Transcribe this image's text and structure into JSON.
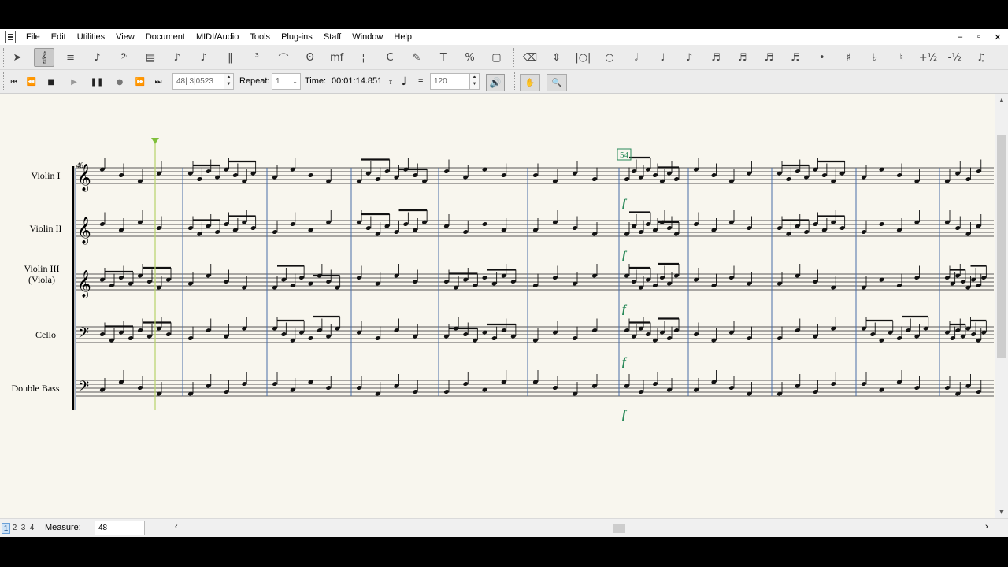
{
  "menu": {
    "items": [
      "File",
      "Edit",
      "Utilities",
      "View",
      "Document",
      "MIDI/Audio",
      "Tools",
      "Plug-ins",
      "Staff",
      "Window",
      "Help"
    ]
  },
  "window_controls": {
    "minimize": "–",
    "restore": "▫",
    "close": "✕"
  },
  "toolbar": {
    "tools": [
      {
        "name": "selection-tool-icon",
        "glyph": "➤"
      },
      {
        "name": "staff-tool-icon",
        "glyph": "𝄞"
      },
      {
        "name": "simple-entry-icon",
        "glyph": "≡"
      },
      {
        "name": "speedy-entry-icon",
        "glyph": "♪"
      },
      {
        "name": "clef-tool-icon",
        "glyph": "𝄢"
      },
      {
        "name": "key-signature-icon",
        "glyph": "▤"
      },
      {
        "name": "time-signature-icon",
        "glyph": "♪"
      },
      {
        "name": "note-mover-icon",
        "glyph": "♪"
      },
      {
        "name": "repeat-tool-icon",
        "glyph": "‖"
      },
      {
        "name": "tuplet-tool-icon",
        "glyph": "³"
      },
      {
        "name": "smart-shape-icon",
        "glyph": "⌒"
      },
      {
        "name": "articulation-icon",
        "glyph": "ʘ"
      },
      {
        "name": "expression-icon",
        "glyph": "mf"
      },
      {
        "name": "measure-tool-icon",
        "glyph": "¦"
      },
      {
        "name": "chord-tool-icon",
        "glyph": "C"
      },
      {
        "name": "lyrics-tool-icon",
        "glyph": "✎"
      },
      {
        "name": "text-tool-icon",
        "glyph": "T"
      },
      {
        "name": "resize-tool-icon",
        "glyph": "%"
      },
      {
        "name": "page-layout-icon",
        "glyph": "▢"
      },
      {
        "name": "eraser-icon",
        "glyph": "⌫"
      },
      {
        "name": "special-tools-icon",
        "glyph": "⇕"
      },
      {
        "name": "breve-icon",
        "glyph": "|○|"
      },
      {
        "name": "whole-note-icon",
        "glyph": "○"
      },
      {
        "name": "half-note-icon",
        "glyph": "𝅗𝅥"
      },
      {
        "name": "quarter-note-icon",
        "glyph": "♩"
      },
      {
        "name": "eighth-note-icon",
        "glyph": "♪"
      },
      {
        "name": "sixteenth-note-icon",
        "glyph": "♬"
      },
      {
        "name": "thirty-second-note-icon",
        "glyph": "♬"
      },
      {
        "name": "sixty-fourth-note-icon",
        "glyph": "♬"
      },
      {
        "name": "one-twenty-eighth-note-icon",
        "glyph": "♬"
      },
      {
        "name": "dot-icon",
        "glyph": "•"
      },
      {
        "name": "sharp-icon",
        "glyph": "♯"
      },
      {
        "name": "flat-icon",
        "glyph": "♭"
      },
      {
        "name": "natural-icon",
        "glyph": "♮"
      },
      {
        "name": "half-step-up-icon",
        "glyph": "+½"
      },
      {
        "name": "half-step-down-icon",
        "glyph": "-½"
      },
      {
        "name": "tie-icon",
        "glyph": "♫"
      },
      {
        "name": "grace-note-icon",
        "glyph": "♪"
      }
    ]
  },
  "playback": {
    "position": "48| 3|0523",
    "repeat_label": "Repeat:",
    "repeat_value": "1",
    "time_label": "Time:",
    "time_value": "00:01:14.851",
    "equals": "=",
    "tempo": "120"
  },
  "score": {
    "measure_number_start": "48",
    "rehearsal_mark": "54",
    "dynamic": "f",
    "staves": [
      {
        "name_line1": "Violin I",
        "name_line2": "",
        "clef": "treble"
      },
      {
        "name_line1": "Violin II",
        "name_line2": "",
        "clef": "treble"
      },
      {
        "name_line1": "Violin III",
        "name_line2": "(Viola)",
        "clef": "treble"
      },
      {
        "name_line1": "Cello",
        "name_line2": "",
        "clef": "bass"
      },
      {
        "name_line1": "Double Bass",
        "name_line2": "",
        "clef": "bass"
      }
    ],
    "measures": [
      [
        "q",
        "8",
        "q",
        "8",
        "q",
        "q",
        "8",
        "q",
        "8",
        "q"
      ],
      [
        "q",
        "8",
        "q",
        "8",
        "q",
        "q",
        "8",
        "q",
        "8",
        "q"
      ],
      [
        "8",
        "q",
        "8",
        "q",
        "8",
        "q",
        "8",
        "q",
        "q",
        "q"
      ],
      [
        "8",
        "q",
        "8",
        "q",
        "8",
        "q",
        "8",
        "q",
        "q",
        "8"
      ],
      [
        "q",
        "q",
        "q",
        "q",
        "q",
        "q",
        "q",
        "q",
        "q",
        "q"
      ]
    ]
  },
  "status": {
    "pages": [
      "1",
      "2",
      "3",
      "4"
    ],
    "active_page": "1",
    "measure_label": "Measure:",
    "measure_value": "48"
  },
  "colors": {
    "paper": "#f8f6ee",
    "barline": "#4a6da8",
    "cursor": "#b7d36a",
    "rehearsal": "#2a8a5a"
  }
}
